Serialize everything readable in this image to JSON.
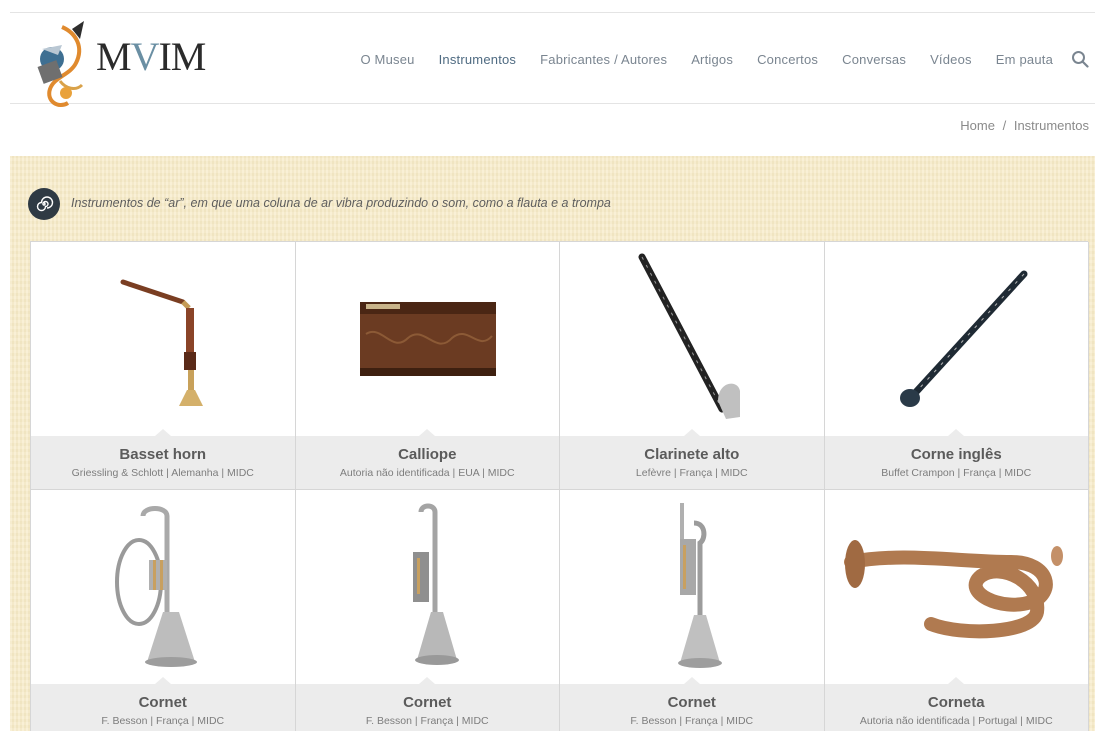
{
  "header": {
    "logo_text_left": "M",
    "logo_text_mid": "V",
    "logo_text_right": "IM",
    "nav": [
      "O Museu",
      "Instrumentos",
      "Fabricantes / Autores",
      "Artigos",
      "Concertos",
      "Conversas",
      "Vídeos",
      "Em pauta"
    ],
    "active_nav": "Instrumentos",
    "search_icon": "search-icon"
  },
  "breadcrumb": {
    "home": "Home",
    "separator": "/",
    "current": "Instrumentos"
  },
  "category": {
    "icon": "spiral-icon",
    "description": "Instrumentos de “ar”, em que uma coluna de ar vibra produzindo o som, como a flauta e a trompa"
  },
  "instruments": [
    {
      "name": "Basset horn",
      "meta": "Griessling & Schlott | Alemanha | MIDC",
      "image": "basset-horn-image"
    },
    {
      "name": "Calliope",
      "meta": "Autoria não identificada | EUA | MIDC",
      "image": "calliope-image"
    },
    {
      "name": "Clarinete alto",
      "meta": "Lefèvre | França | MIDC",
      "image": "alto-clarinet-image"
    },
    {
      "name": "Corne inglês",
      "meta": "Buffet Crampon | França | MIDC",
      "image": "english-horn-image"
    },
    {
      "name": "Cornet",
      "meta": "F. Besson | França | MIDC",
      "image": "cornet-image"
    },
    {
      "name": "Cornet",
      "meta": "F. Besson | França | MIDC",
      "image": "cornet-image"
    },
    {
      "name": "Cornet",
      "meta": "F. Besson | França | MIDC",
      "image": "cornet-image"
    },
    {
      "name": "Corneta",
      "meta": "Autoria não identificada | Portugal | MIDC",
      "image": "corneta-image"
    }
  ],
  "colors": {
    "parchment": "#f7ebc6",
    "caption_bg": "#ececec",
    "nav_active": "#4f6b82",
    "nav_text": "#7a8590"
  }
}
